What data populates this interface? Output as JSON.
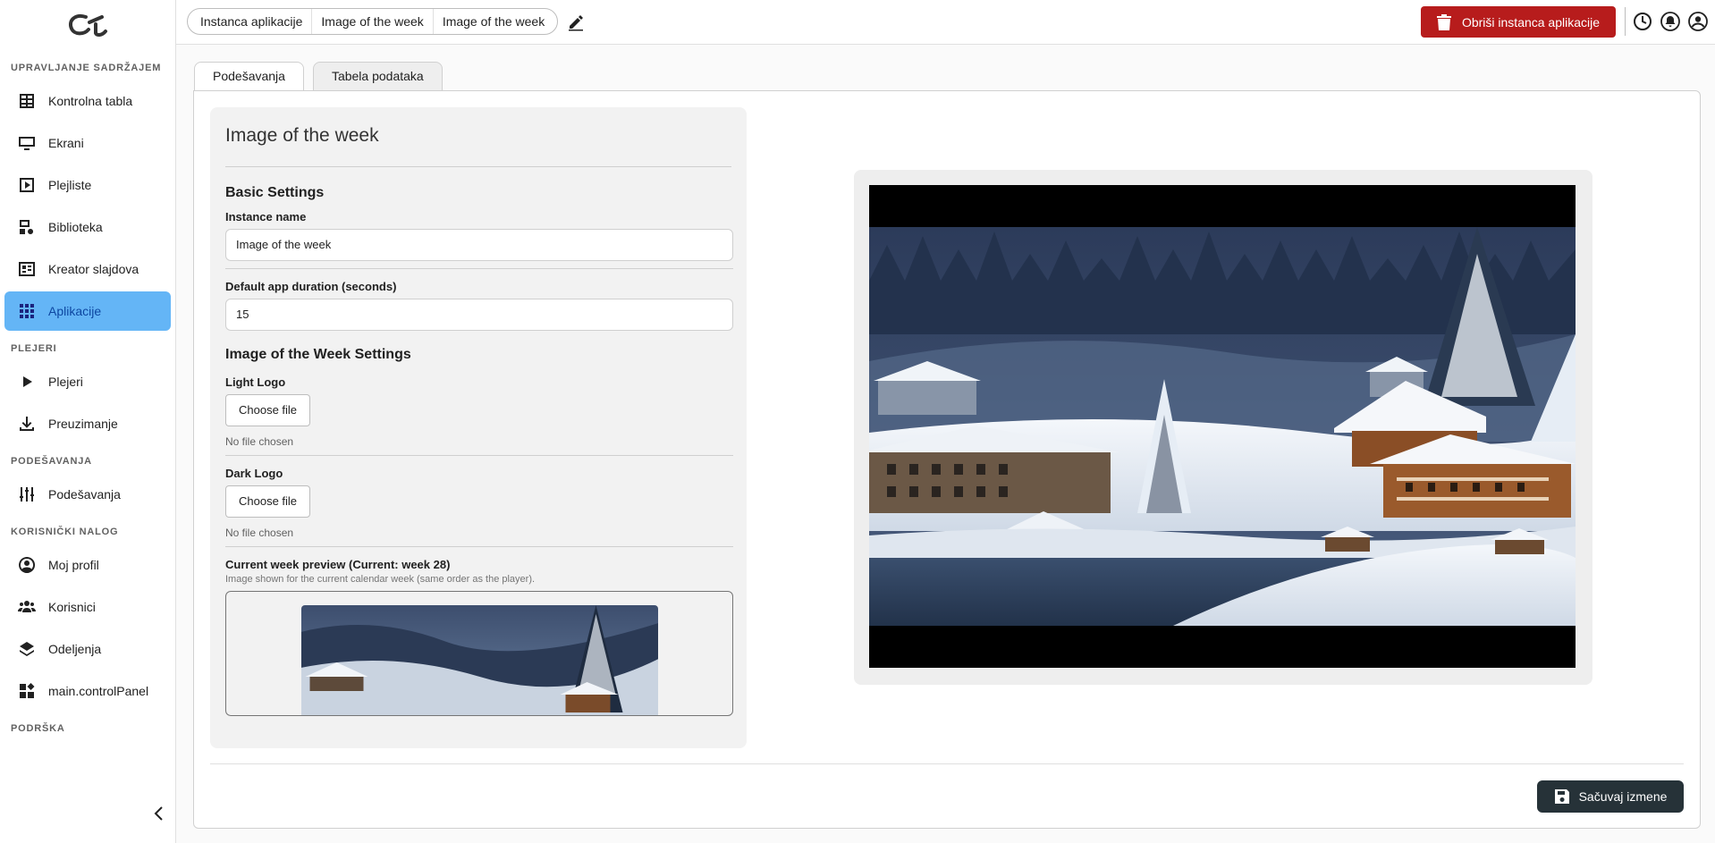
{
  "sidebar": {
    "sections": [
      {
        "title": "UPRAVLJANJE SADRŽAJEM"
      },
      {
        "title": "PLEJERI"
      },
      {
        "title": "PODEŠAVANJA"
      },
      {
        "title": "KORISNIČKI NALOG"
      },
      {
        "title": "PODRŠKA"
      }
    ],
    "items": [
      {
        "label": "Kontrolna tabla",
        "icon": "dashboard-icon"
      },
      {
        "label": "Ekrani",
        "icon": "monitor-icon"
      },
      {
        "label": "Plejliste",
        "icon": "playlist-icon"
      },
      {
        "label": "Biblioteka",
        "icon": "library-icon"
      },
      {
        "label": "Kreator slajdova",
        "icon": "slide-creator-icon"
      },
      {
        "label": "Aplikacije",
        "icon": "apps-grid-icon",
        "active": true
      },
      {
        "label": "Plejeri",
        "icon": "play-icon"
      },
      {
        "label": "Preuzimanje",
        "icon": "download-icon"
      },
      {
        "label": "Podešavanja",
        "icon": "sliders-icon"
      },
      {
        "label": "Moj profil",
        "icon": "profile-icon"
      },
      {
        "label": "Korisnici",
        "icon": "users-icon"
      },
      {
        "label": "Odeljenja",
        "icon": "layers-icon"
      },
      {
        "label": "main.controlPanel",
        "icon": "control-panel-icon"
      }
    ]
  },
  "topbar": {
    "breadcrumbs": [
      "Instanca aplikacije",
      "Image of the week",
      "Image of the week"
    ],
    "delete_label": "Obriši instanca aplikacije",
    "accent": "#b71c1c"
  },
  "tabs": [
    {
      "label": "Podešavanja",
      "active": true
    },
    {
      "label": "Tabela podataka",
      "active": false
    }
  ],
  "form": {
    "title": "Image of the week",
    "basic_heading": "Basic Settings",
    "instance_name_label": "Instance name",
    "instance_name_value": "Image of the week",
    "duration_label": "Default app duration (seconds)",
    "duration_value": "15",
    "iotw_heading": "Image of the Week Settings",
    "light_logo_label": "Light Logo",
    "dark_logo_label": "Dark Logo",
    "choose_file": "Choose file",
    "no_file": "No file chosen",
    "current_week_label": "Current week preview (Current: week 28)",
    "current_week_hint": "Image shown for the current calendar week (same order as the player)."
  },
  "footer": {
    "save_label": "Sačuvaj izmene"
  }
}
